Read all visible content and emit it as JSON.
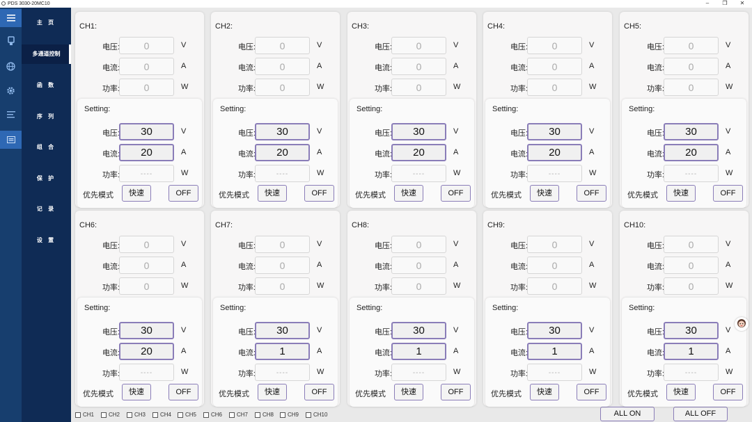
{
  "window": {
    "title": "PDS 3030-20MC10",
    "minimize": "–",
    "maximize": "❐",
    "close": "✕"
  },
  "sidebar_icons": [
    "menu-icon",
    "device-icon",
    "globe-icon",
    "gear-icon",
    "list-icon",
    "panel-icon"
  ],
  "nav": [
    {
      "label": "主 页",
      "active": false
    },
    {
      "label": "多通道控制",
      "active": true
    },
    {
      "label": "函 数",
      "active": false
    },
    {
      "label": "序 列",
      "active": false
    },
    {
      "label": "组 合",
      "active": false
    },
    {
      "label": "保 护",
      "active": false
    },
    {
      "label": "记 录",
      "active": false
    },
    {
      "label": "设 置",
      "active": false
    }
  ],
  "labels": {
    "voltage": "电压:",
    "current": "电流:",
    "power": "功率:",
    "unit_v": "V",
    "unit_a": "A",
    "unit_w": "W",
    "setting": "Setting:",
    "priority": "优先模式",
    "fast": "快速",
    "off": "OFF",
    "power_placeholder": "----"
  },
  "channels": [
    {
      "name": "CH1:",
      "v": "0",
      "a": "0",
      "w": "0",
      "set_v": "30",
      "set_a": "20"
    },
    {
      "name": "CH2:",
      "v": "0",
      "a": "0",
      "w": "0",
      "set_v": "30",
      "set_a": "20"
    },
    {
      "name": "CH3:",
      "v": "0",
      "a": "0",
      "w": "0",
      "set_v": "30",
      "set_a": "20"
    },
    {
      "name": "CH4:",
      "v": "0",
      "a": "0",
      "w": "0",
      "set_v": "30",
      "set_a": "20"
    },
    {
      "name": "CH5:",
      "v": "0",
      "a": "0",
      "w": "0",
      "set_v": "30",
      "set_a": "20"
    },
    {
      "name": "CH6:",
      "v": "0",
      "a": "0",
      "w": "0",
      "set_v": "30",
      "set_a": "20"
    },
    {
      "name": "CH7:",
      "v": "0",
      "a": "0",
      "w": "0",
      "set_v": "30",
      "set_a": "1"
    },
    {
      "name": "CH8:",
      "v": "0",
      "a": "0",
      "w": "0",
      "set_v": "30",
      "set_a": "1"
    },
    {
      "name": "CH9:",
      "v": "0",
      "a": "0",
      "w": "0",
      "set_v": "30",
      "set_a": "1"
    },
    {
      "name": "CH10:",
      "v": "0",
      "a": "0",
      "w": "0",
      "set_v": "30",
      "set_a": "1"
    }
  ],
  "checkboxes": [
    "CH1",
    "CH2",
    "CH3",
    "CH4",
    "CH5",
    "CH6",
    "CH7",
    "CH8",
    "CH9",
    "CH10"
  ],
  "buttons": {
    "all_on": "ALL ON",
    "all_off": "ALL OFF"
  },
  "colors": {
    "sidebar": "#173e6e",
    "nav": "#0f2b55",
    "accent": "#8a7db8"
  }
}
